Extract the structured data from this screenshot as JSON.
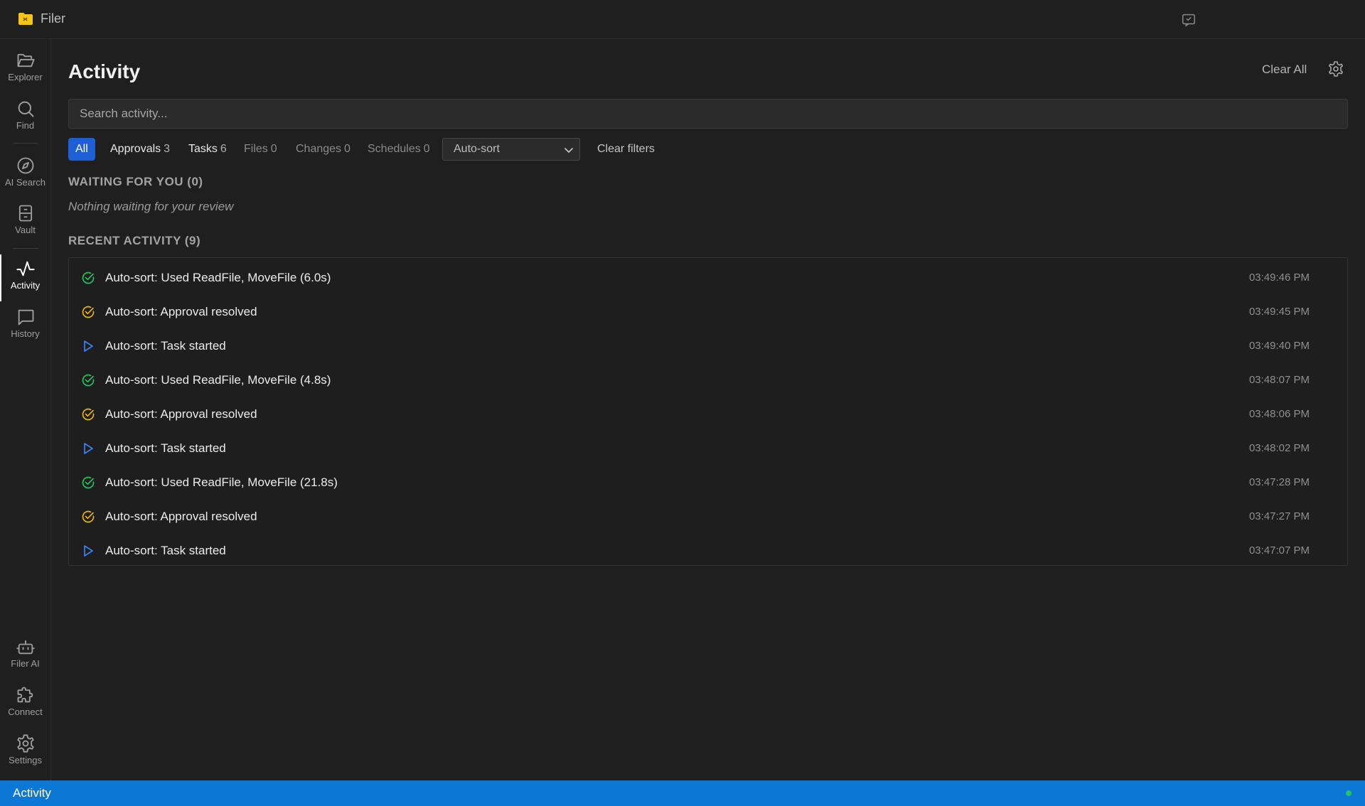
{
  "app": {
    "title": "Filer"
  },
  "sidebar": {
    "items": [
      {
        "label": "Explorer",
        "icon": "folder-open-icon"
      },
      {
        "label": "Find",
        "icon": "search-icon"
      },
      {
        "label": "AI Search",
        "icon": "compass-icon"
      },
      {
        "label": "Vault",
        "icon": "archive-icon"
      },
      {
        "label": "Activity",
        "icon": "activity-pulse-icon",
        "active": true
      },
      {
        "label": "History",
        "icon": "message-square-icon"
      },
      {
        "label": "Filer AI",
        "icon": "robot-icon"
      },
      {
        "label": "Connect",
        "icon": "puzzle-icon"
      },
      {
        "label": "Settings",
        "icon": "gear-icon"
      }
    ]
  },
  "header": {
    "title": "Activity",
    "clear_all": "Clear All"
  },
  "search": {
    "placeholder": "Search activity...",
    "value": ""
  },
  "filters": {
    "tabs": [
      {
        "label": "All",
        "count": null,
        "active": true
      },
      {
        "label": "Approvals",
        "count": "3"
      },
      {
        "label": "Tasks",
        "count": "6"
      },
      {
        "label": "Files",
        "count": "0"
      },
      {
        "label": "Changes",
        "count": "0"
      },
      {
        "label": "Schedules",
        "count": "0"
      }
    ],
    "source_select": "Auto-sort",
    "clear_filters": "Clear filters"
  },
  "waiting": {
    "heading": "WAITING FOR YOU (0)",
    "empty_text": "Nothing waiting for your review"
  },
  "recent": {
    "heading": "RECENT ACTIVITY (9)",
    "items": [
      {
        "status": "success",
        "icon": "check-circle-icon",
        "text": "Auto-sort: Used ReadFile, MoveFile (6.0s)",
        "time": "03:49:46 PM"
      },
      {
        "status": "approval",
        "icon": "check-circle-icon",
        "text": "Auto-sort: Approval resolved",
        "time": "03:49:45 PM"
      },
      {
        "status": "started",
        "icon": "play-icon",
        "text": "Auto-sort: Task started",
        "time": "03:49:40 PM"
      },
      {
        "status": "success",
        "icon": "check-circle-icon",
        "text": "Auto-sort: Used ReadFile, MoveFile (4.8s)",
        "time": "03:48:07 PM"
      },
      {
        "status": "approval",
        "icon": "check-circle-icon",
        "text": "Auto-sort: Approval resolved",
        "time": "03:48:06 PM"
      },
      {
        "status": "started",
        "icon": "play-icon",
        "text": "Auto-sort: Task started",
        "time": "03:48:02 PM"
      },
      {
        "status": "success",
        "icon": "check-circle-icon",
        "text": "Auto-sort: Used ReadFile, MoveFile (21.8s)",
        "time": "03:47:28 PM"
      },
      {
        "status": "approval",
        "icon": "check-circle-icon",
        "text": "Auto-sort: Approval resolved",
        "time": "03:47:27 PM"
      },
      {
        "status": "started",
        "icon": "play-icon",
        "text": "Auto-sort: Task started",
        "time": "03:47:07 PM"
      }
    ]
  },
  "status_bar": {
    "text": "Activity",
    "connection": "online"
  },
  "colors": {
    "accent": "#1f5fd6",
    "status_bar": "#0a78d4",
    "success": "#22c55e",
    "approval": "#eab308",
    "started": "#3b82f6"
  }
}
